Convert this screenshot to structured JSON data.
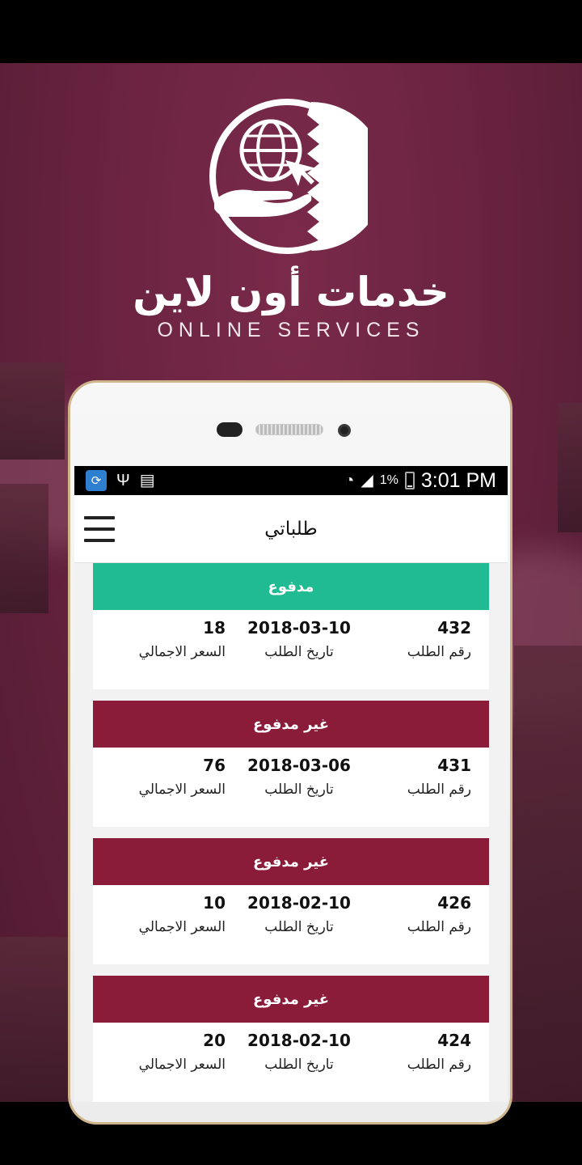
{
  "brand": {
    "name_ar": "خدمات أون لاين",
    "name_en": "ONLINE SERVICES"
  },
  "colors": {
    "paid": "#20bb93",
    "unpaid": "#8a1c3a",
    "background": "#6a2341"
  },
  "status_bar": {
    "time": "3:01 PM",
    "battery": "1%",
    "icons": [
      "app-icon",
      "usb-icon",
      "sim-icon",
      "wifi-icon",
      "signal-icon",
      "battery-icon"
    ]
  },
  "appbar": {
    "title": "طلباتي",
    "menu_icon": "hamburger-icon"
  },
  "labels": {
    "order_number": "رقم الطلب",
    "order_date": "تاريخ الطلب",
    "total_price": "السعر الاجمالي"
  },
  "orders": [
    {
      "status": "مدفوع",
      "number": "432",
      "date": "2018-03-10",
      "price": "18"
    },
    {
      "status": "غير مدفوع",
      "number": "431",
      "date": "2018-03-06",
      "price": "76"
    },
    {
      "status": "غير مدفوع",
      "number": "426",
      "date": "2018-02-10",
      "price": "10"
    },
    {
      "status": "غير مدفوع",
      "number": "424",
      "date": "2018-02-10",
      "price": "20"
    }
  ]
}
